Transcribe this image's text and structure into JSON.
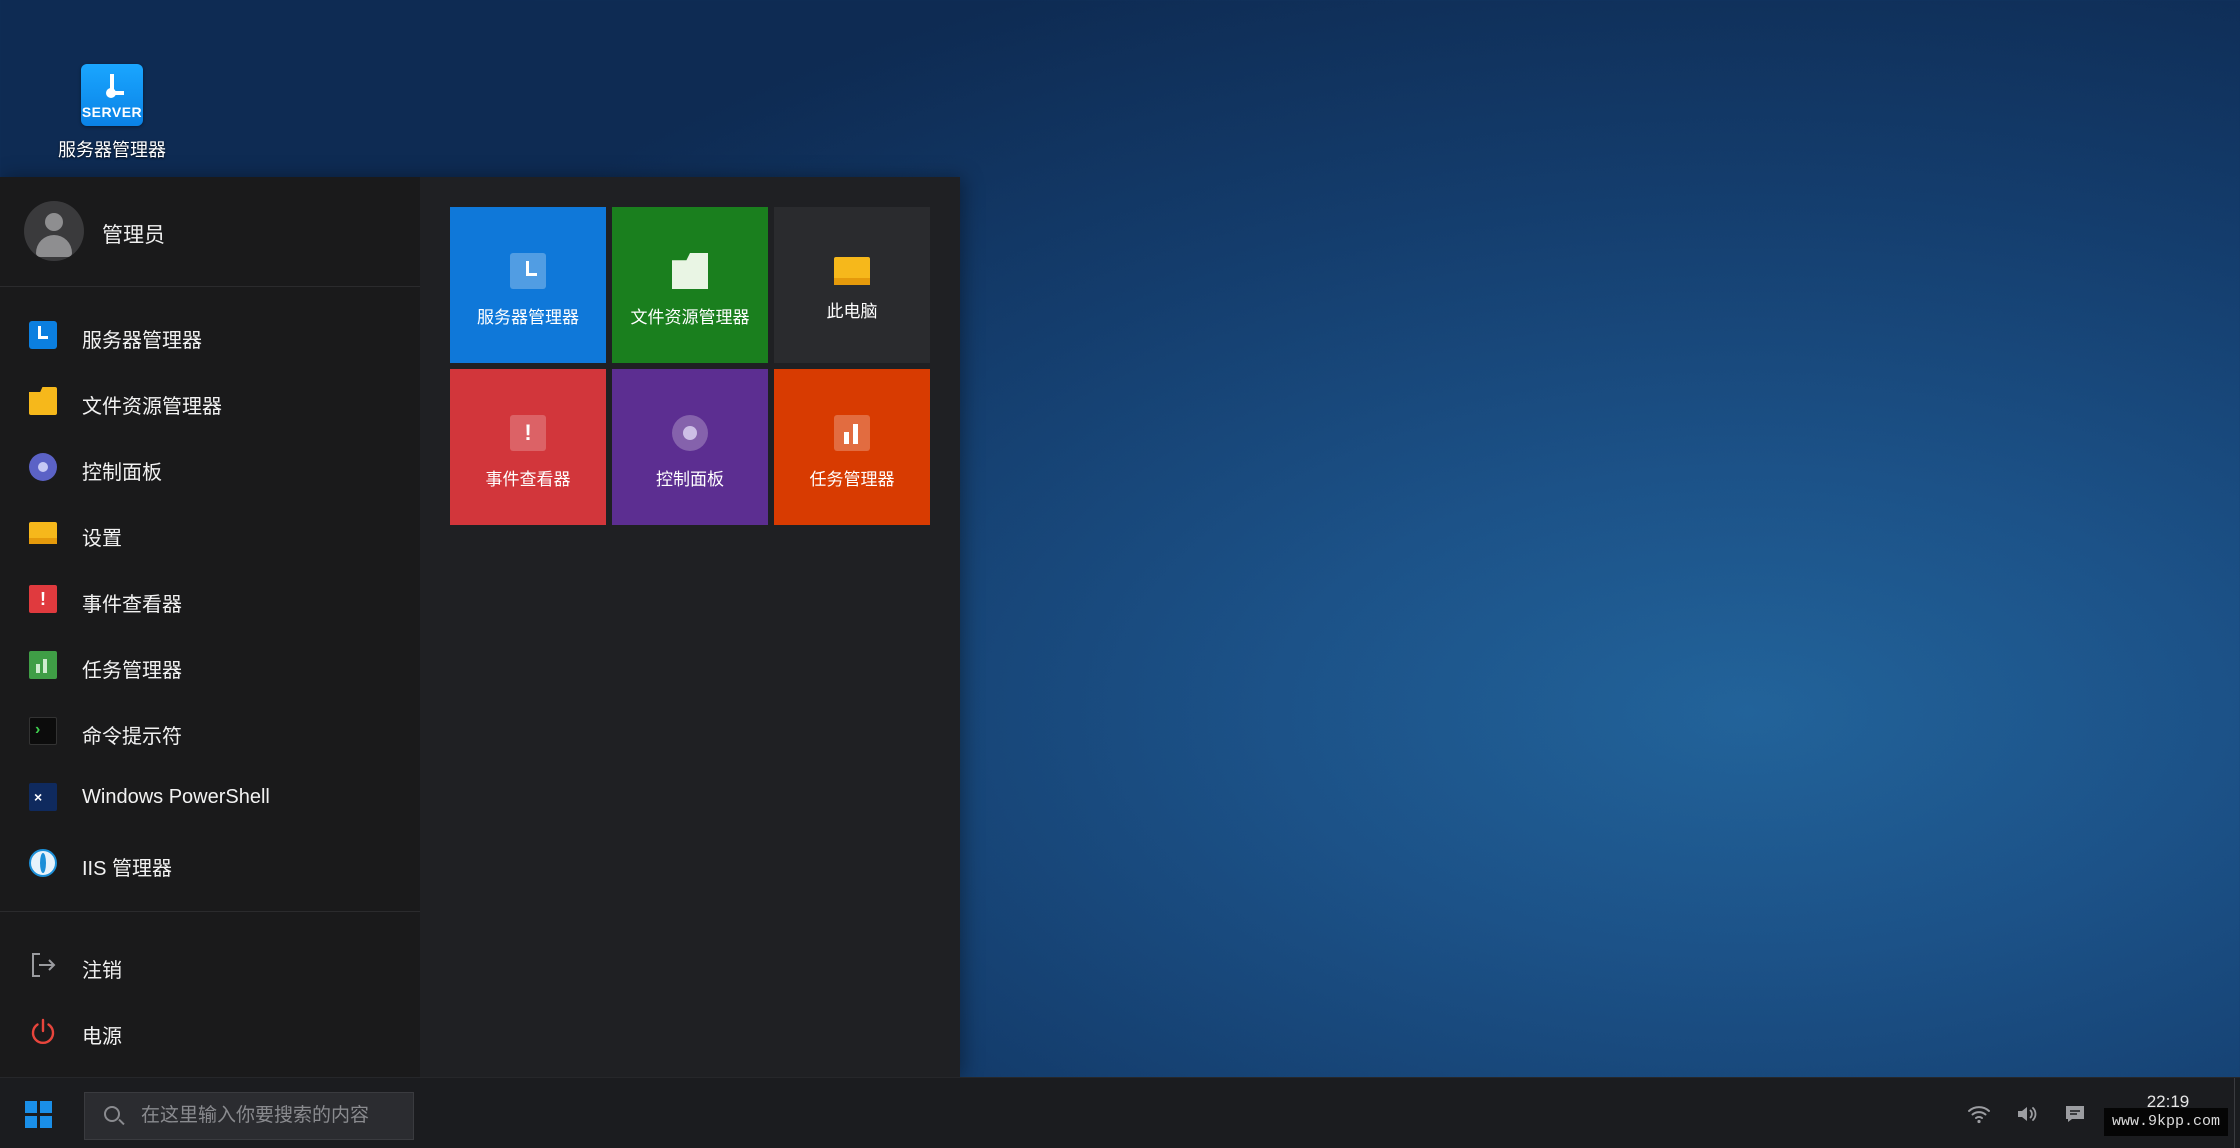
{
  "desktop": {
    "icon_server_badge": "SERVER",
    "icon_server_label": "服务器管理器"
  },
  "start_menu": {
    "user_name": "管理员",
    "apps": [
      {
        "label": "服务器管理器",
        "icon": "server-manager-icon"
      },
      {
        "label": "文件资源管理器",
        "icon": "folder-icon"
      },
      {
        "label": "控制面板",
        "icon": "control-panel-icon"
      },
      {
        "label": "设置",
        "icon": "settings-icon"
      },
      {
        "label": "事件查看器",
        "icon": "event-viewer-icon"
      },
      {
        "label": "任务管理器",
        "icon": "task-manager-icon"
      },
      {
        "label": "命令提示符",
        "icon": "command-prompt-icon"
      },
      {
        "label": "Windows PowerShell",
        "icon": "powershell-icon"
      },
      {
        "label": "IIS 管理器",
        "icon": "iis-icon"
      }
    ],
    "bottom": [
      {
        "label": "注销",
        "icon": "sign-out-icon"
      },
      {
        "label": "电源",
        "icon": "power-icon"
      }
    ],
    "tiles": [
      {
        "label": "服务器管理器",
        "color": "#0f78d9",
        "icon": "server-manager-icon"
      },
      {
        "label": "文件资源管理器",
        "color": "#1a7f1e",
        "icon": "folder-icon"
      },
      {
        "label": "此电脑",
        "color": "#2a2b2e",
        "icon": "this-pc-icon"
      },
      {
        "label": "事件查看器",
        "color": "#d2363b",
        "icon": "event-viewer-icon"
      },
      {
        "label": "控制面板",
        "color": "#5c2e91",
        "icon": "control-panel-icon"
      },
      {
        "label": "任务管理器",
        "color": "#d83b01",
        "icon": "task-manager-icon"
      }
    ]
  },
  "taskbar": {
    "search_placeholder": "在这里输入你要搜索的内容",
    "time": "22:19",
    "watermark": "www.9kpp.com",
    "start_icon": "windows-logo-icon",
    "tray_icons": [
      "wifi-icon",
      "volume-icon",
      "notification-icon"
    ]
  },
  "colors": {
    "accent": "#0f78d9",
    "menu_bg": "#1f2023",
    "taskbar_bg": "#1b1c1f"
  }
}
